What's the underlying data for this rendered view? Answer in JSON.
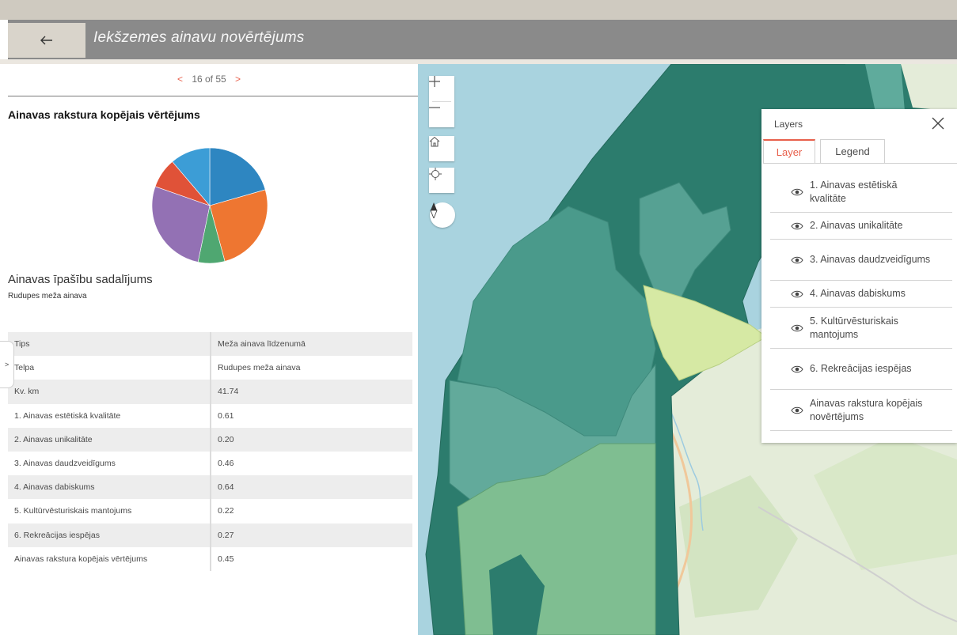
{
  "header": {
    "back_icon": "arrow-left-icon",
    "title": "Iekšzemes ainavu novērtējums"
  },
  "pager": {
    "prev": "<",
    "text": "16 of 55",
    "next": ">"
  },
  "chart_section": {
    "title": "Ainavas rakstura kopējais vērtējums"
  },
  "chart_data": {
    "type": "pie",
    "title": "Ainavas rakstura kopējais vērtējums",
    "categories": [
      "1. Ainavas estētiskā kvalitāte",
      "2. Ainavas unikalitāte",
      "3. Ainavas daudzveidīgums",
      "4. Ainavas dabiskums",
      "5. Kultūrvēsturiskais mantojums",
      "6. Rekreācijas iespējas"
    ],
    "values": [
      0.22,
      0.27,
      0.08,
      0.29,
      0.09,
      0.12
    ],
    "colors": [
      "#2e86c1",
      "#ee7631",
      "#4fa771",
      "#9371b4",
      "#e05238",
      "#3c9dd6"
    ]
  },
  "breakdown": {
    "title": "Ainavas īpašību sadalījums",
    "subtitle": "Rudupes meža ainava",
    "rows": [
      {
        "label": "Tips",
        "value": "Meža ainava līdzenumā"
      },
      {
        "label": "Telpa",
        "value": "Rudupes meža ainava"
      },
      {
        "label": "Kv. km",
        "value": "41.74"
      },
      {
        "label": "1. Ainavas estētiskā kvalitāte",
        "value": "0.61"
      },
      {
        "label": "2. Ainavas unikalitāte",
        "value": "0.20"
      },
      {
        "label": "3. Ainavas daudzveidīgums",
        "value": "0.46"
      },
      {
        "label": "4. Ainavas dabiskums",
        "value": "0.64"
      },
      {
        "label": "5. Kultūrvēsturiskais mantojums",
        "value": "0.22"
      },
      {
        "label": "6. Rekreācijas iespējas",
        "value": "0.27"
      },
      {
        "label": "Ainavas rakstura kopējais vērtējums",
        "value": "0.45"
      }
    ]
  },
  "side_toggle": ">",
  "map_controls": {
    "zoom_in": "+",
    "zoom_out": "—",
    "home_icon": "home-icon",
    "locate_icon": "locate-crosshair-icon",
    "compass_icon": "compass-icon"
  },
  "layers_panel": {
    "title": "Layers",
    "close_icon": "close-icon",
    "tabs": [
      "Layer",
      "Legend"
    ],
    "active_tab": "Layer",
    "accent": "#e8604c",
    "items": [
      "1. Ainavas estētiskā kvalitāte",
      "2. Ainavas unikalitāte",
      "3. Ainavas daudzveidīgums",
      "4. Ainavas dabiskums",
      "5. Kultūrvēsturiskais mantojums",
      "6. Rekreācijas iespējas",
      "Ainavas rakstura kopējais novērtējums"
    ]
  },
  "map_colors": {
    "water": "#a9d3df",
    "dark_teal": "#2c7c6d",
    "mid_teal": "#4a9a8b",
    "light_teal": "#62aa9b",
    "green": "#7fbe91",
    "light_green": "#d6e9a4",
    "basemap": "#e4ecd9"
  }
}
